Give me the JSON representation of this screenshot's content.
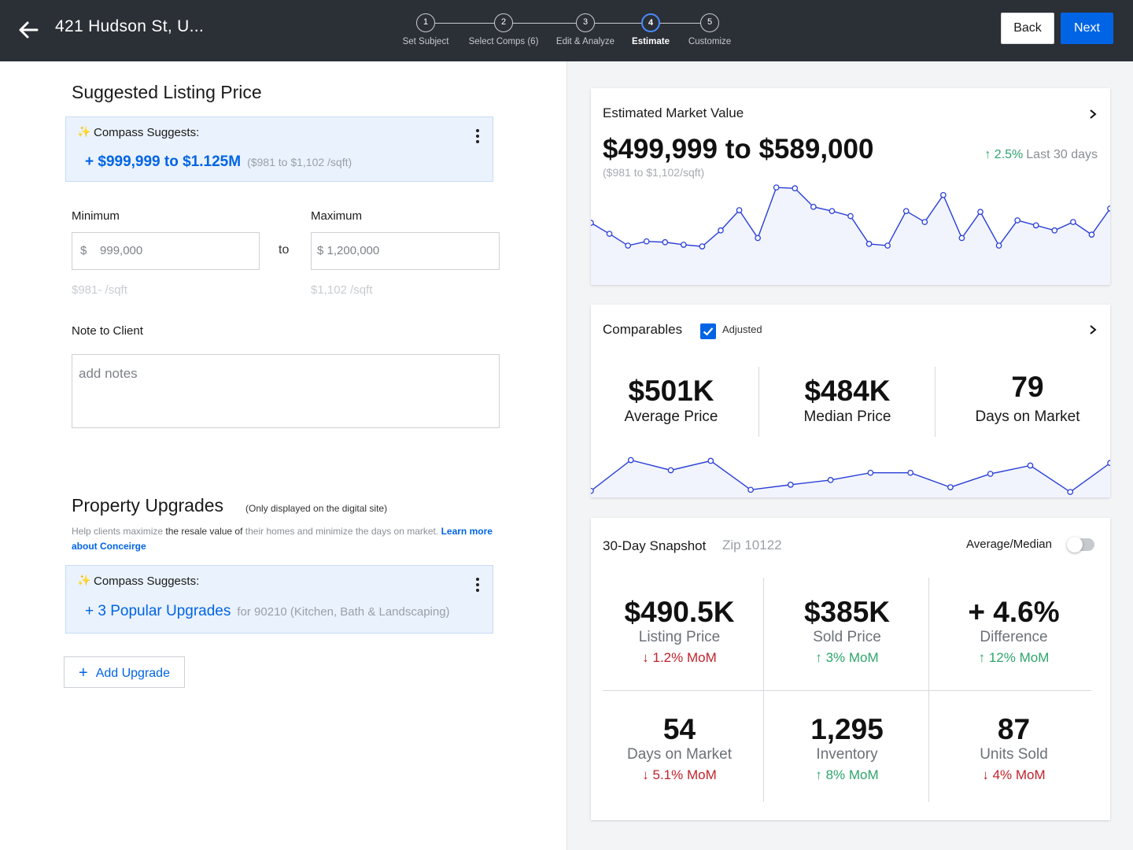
{
  "header": {
    "address": "421 Hudson St,  U...",
    "steps": [
      {
        "num": "1",
        "label": "Set Subject"
      },
      {
        "num": "2",
        "label": "Select Comps (6)"
      },
      {
        "num": "3",
        "label": "Edit & Analyze"
      },
      {
        "num": "4",
        "label": "Estimate"
      },
      {
        "num": "5",
        "label": "Customize"
      }
    ],
    "active_step": 4,
    "back_label": "Back",
    "next_label": "Next"
  },
  "listing": {
    "title": "Suggested Listing Price",
    "suggest_label": "Compass Suggests:",
    "suggest_range": "+ $999,999 to $1.125M",
    "suggest_sqft": "($981 to $1,102 /sqft)",
    "min_label": "Minimum",
    "max_label": "Maximum",
    "min_value": "$    999,000",
    "max_value": "$ 1,200,000",
    "to": "to",
    "min_sqft": "$981- /sqft",
    "max_sqft": "$1,102 /sqft",
    "note_label": "Note to Client",
    "note_placeholder": "add notes"
  },
  "upgrades": {
    "title": "Property Upgrades",
    "note": "(Only displayed on the digital site)",
    "help_1": "Help clients maximize ",
    "help_2": "the resale value of",
    "help_3": " their homes and minimize the days on market. ",
    "help_link": "Learn more about Conceirge",
    "suggest_label": "Compass Suggests:",
    "suggest_text": "+ 3 Popular Upgrades",
    "suggest_sub": "for 90210 (Kitchen, Bath & Landscaping)",
    "add_label": "Add Upgrade"
  },
  "emv": {
    "title": "Estimated Market Value",
    "range": "$499,999 to $589,000",
    "sqft": "($981 to $1,102/sqft)",
    "change_pct": "2.5%",
    "change_period": "Last 30 days",
    "trend": [
      0.55,
      0.42,
      0.28,
      0.33,
      0.32,
      0.29,
      0.27,
      0.46,
      0.7,
      0.37,
      0.97,
      0.96,
      0.74,
      0.69,
      0.63,
      0.3,
      0.28,
      0.69,
      0.56,
      0.88,
      0.37,
      0.68,
      0.28,
      0.58,
      0.52,
      0.46,
      0.56,
      0.41,
      0.72
    ]
  },
  "comparables": {
    "title": "Comparables",
    "adjusted_label": "Adjusted",
    "adjusted": true,
    "stats": [
      {
        "value": "$501K",
        "label": "Average Price"
      },
      {
        "value": "$484K",
        "label": "Median Price"
      },
      {
        "value": "79",
        "label": "Days on Market"
      }
    ],
    "trend": [
      0.05,
      0.9,
      0.62,
      0.88,
      0.08,
      0.22,
      0.35,
      0.55,
      0.55,
      0.15,
      0.52,
      0.75,
      0.02,
      0.82
    ]
  },
  "snapshot": {
    "title": "30-Day Snapshot",
    "zip": "Zip 10122",
    "toggle_label": "Average/Median",
    "toggle_on": false,
    "cells": [
      {
        "value": "$490.5K",
        "label": "Listing Price",
        "change": "1.2% MoM",
        "dir": "down"
      },
      {
        "value": "$385K",
        "label": "Sold Price",
        "change": "3% MoM",
        "dir": "up"
      },
      {
        "value": "+ 4.6%",
        "label": "Difference",
        "change": "12% MoM",
        "dir": "up"
      },
      {
        "value": "54",
        "label": "Days on Market",
        "change": "5.1% MoM",
        "dir": "down"
      },
      {
        "value": "1,295",
        "label": "Inventory",
        "change": "8% MoM",
        "dir": "up"
      },
      {
        "value": "87",
        "label": "Units Sold",
        "change": "4% MoM",
        "dir": "down"
      }
    ]
  },
  "colors": {
    "accent": "#0064e5",
    "up": "#2ea56b",
    "down": "#c0232c",
    "header_bg": "#2b2f36",
    "chart_line": "#2a3fd6"
  },
  "icons": {
    "back": "arrow-left-icon",
    "chevron": "chevron-right-icon",
    "sparkle": "sparkle-icon",
    "menu": "kebab-menu-icon",
    "check": "checkmark-icon",
    "plus": "plus-icon"
  }
}
